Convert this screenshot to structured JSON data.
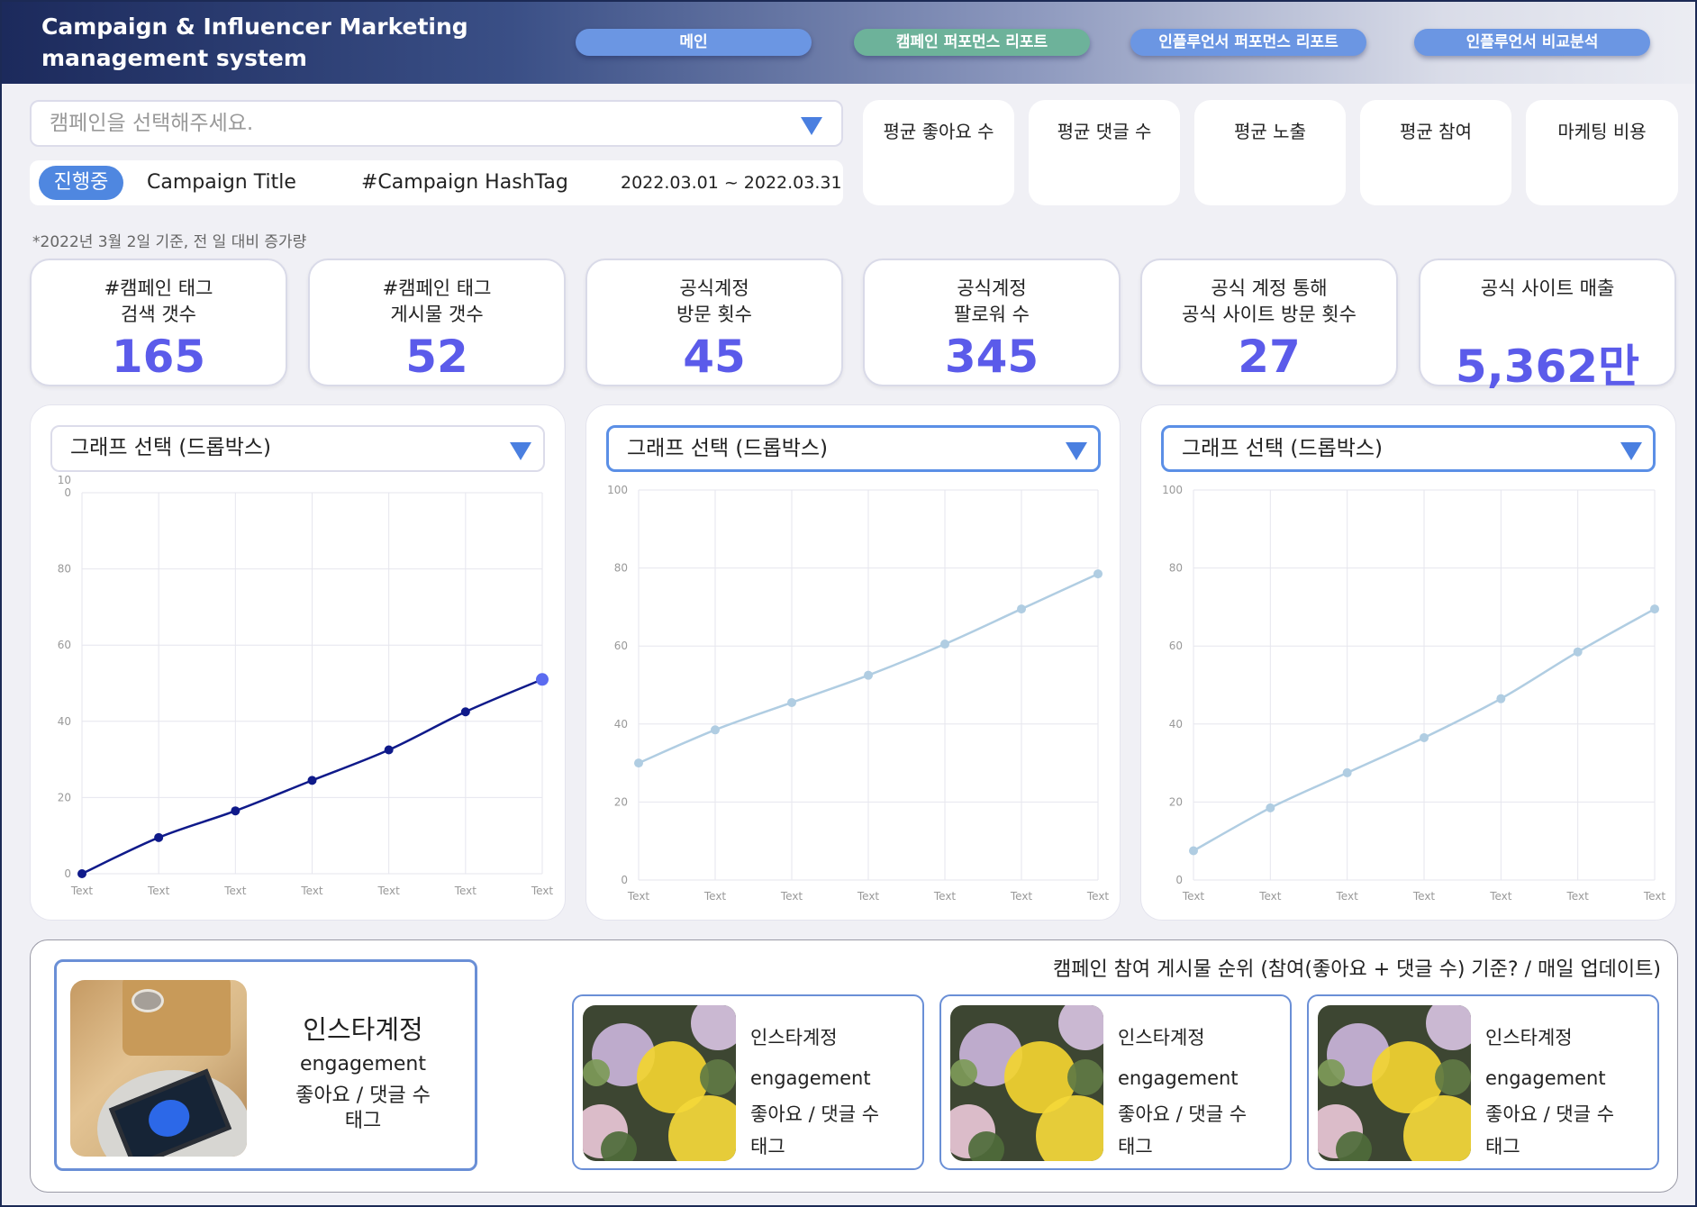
{
  "brand": {
    "line1": "Campaign & Influencer Marketing",
    "line2": "management system"
  },
  "nav": [
    {
      "label": "메인",
      "color": "#6b96e3"
    },
    {
      "label": "캠페인 퍼포먼스 리포트",
      "color": "#6db29a"
    },
    {
      "label": "인플루언서 퍼포먼스 리포트",
      "color": "#6b96e3"
    },
    {
      "label": "인플루언서 비교분석",
      "color": "#6b96e3"
    }
  ],
  "campaign_select": {
    "placeholder": "캠페인을 선택해주세요."
  },
  "campaign_info": {
    "status": "진행중",
    "title": "Campaign Title",
    "hashtag": "#Campaign HashTag",
    "period": "2022.03.01 ~ 2022.03.31"
  },
  "averages": [
    "평균 좋아요 수",
    "평균 댓글 수",
    "평균 노출",
    "평균 참여",
    "마케팅 비용"
  ],
  "note": "*2022년 3월 2일 기준, 전 일 대비  증가량",
  "stats": [
    {
      "line1": "#캠페인 태그",
      "line2": "검색 갯수",
      "value": "165"
    },
    {
      "line1": "#캠페인 태그",
      "line2": "게시물 갯수",
      "value": "52"
    },
    {
      "line1": "공식계정",
      "line2": "방문 횟수",
      "value": "45"
    },
    {
      "line1": "공식계정",
      "line2": "팔로워 수",
      "value": "345"
    },
    {
      "line1": "공식 계정 통해",
      "line2": "공식 사이트 방문 횟수",
      "value": "27"
    },
    {
      "line1": "공식 사이트 매출",
      "line2": "",
      "value": "5,362만"
    }
  ],
  "graph_dropdown_label": "그래프 선택 (드롭박스)",
  "chart_data": [
    {
      "type": "line",
      "categories": [
        "Text",
        "Text",
        "Text",
        "Text",
        "Text",
        "Text",
        "Text"
      ],
      "values": [
        0,
        9.5,
        16.5,
        24.5,
        32.5,
        42.5,
        51
      ],
      "ylim": [
        0,
        100
      ],
      "yticks": [
        "0",
        "20",
        "40",
        "60",
        "80",
        "10\n0"
      ],
      "color": "#0f1a8a",
      "last_point_color": "#5b6bf0"
    },
    {
      "type": "line",
      "categories": [
        "Text",
        "Text",
        "Text",
        "Text",
        "Text",
        "Text",
        "Text"
      ],
      "values": [
        30,
        38.5,
        45.5,
        52.5,
        60.5,
        69.5,
        78.5
      ],
      "ylim": [
        0,
        100
      ],
      "yticks": [
        "0",
        "20",
        "40",
        "60",
        "80",
        "100"
      ],
      "color": "#b0cde2"
    },
    {
      "type": "line",
      "categories": [
        "Text",
        "Text",
        "Text",
        "Text",
        "Text",
        "Text",
        "Text"
      ],
      "values": [
        7.5,
        18.5,
        27.5,
        36.5,
        46.5,
        58.5,
        69.5
      ],
      "ylim": [
        0,
        100
      ],
      "yticks": [
        "0",
        "20",
        "40",
        "60",
        "80",
        "100"
      ],
      "color": "#b0cde2"
    }
  ],
  "ranking": {
    "title": "캠페인 참여 게시물 순위 (참여(좋아요 + 댓글 수) 기준? / 매일 업데이트)",
    "featured": {
      "account": "인스타계정",
      "engagement": "engagement",
      "likes": "좋아요 / 댓글 수",
      "tag": "태그"
    },
    "posts": [
      {
        "account": "인스타계정",
        "engagement": "engagement",
        "likes": "좋아요 / 댓글 수",
        "tag": "태그"
      },
      {
        "account": "인스타계정",
        "engagement": "engagement",
        "likes": "좋아요 / 댓글 수",
        "tag": "태그"
      },
      {
        "account": "인스타계정",
        "engagement": "engagement",
        "likes": "좋아요 / 댓글 수",
        "tag": "태그"
      }
    ]
  }
}
